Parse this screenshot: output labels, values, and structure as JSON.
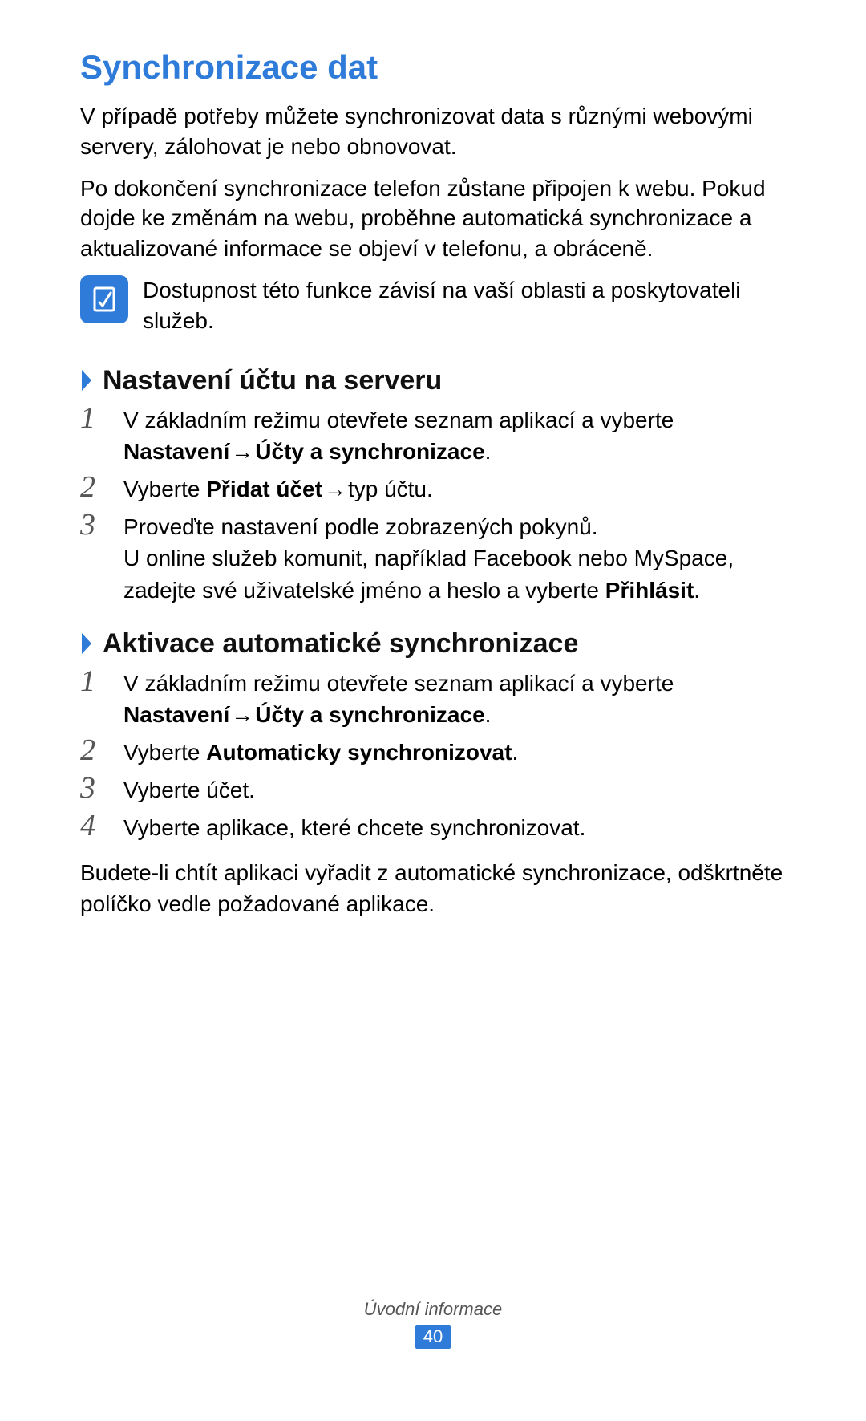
{
  "colors": {
    "accent": "#2f7bd9"
  },
  "heading": "Synchronizace dat",
  "intro_p1": "V případě potřeby můžete synchronizovat data s různými webovými servery, zálohovat je nebo obnovovat.",
  "intro_p2": "Po dokončení synchronizace telefon zůstane připojen k webu. Pokud dojde ke změnám na webu, proběhne automatická synchronizace a aktualizované informace se objeví v telefonu, a obráceně.",
  "note_icon": "note-icon",
  "note_text": "Dostupnost této funkce závisí na vaší oblasti a poskytovateli služeb.",
  "section1": {
    "title": "Nastavení účtu na serveru",
    "steps": {
      "s1": {
        "num": "1",
        "a": "V základním režimu otevřete seznam aplikací a vyberte ",
        "b1": "Nastavení",
        "arrow": " → ",
        "b2": "Účty a synchronizace",
        "c": "."
      },
      "s2": {
        "num": "2",
        "a": "Vyberte ",
        "b": "Přidat účet",
        "arrow": " → ",
        "c": "typ účtu."
      },
      "s3": {
        "num": "3",
        "line1": "Proveďte nastavení podle zobrazených pokynů.",
        "line2a": "U online služeb komunit, například Facebook nebo MySpace, zadejte své uživatelské jméno a heslo a vyberte ",
        "line2b": "Přihlásit",
        "line2c": "."
      }
    }
  },
  "section2": {
    "title": "Aktivace automatické synchronizace",
    "steps": {
      "s1": {
        "num": "1",
        "a": "V základním režimu otevřete seznam aplikací a vyberte ",
        "b1": "Nastavení",
        "arrow": " → ",
        "b2": "Účty a synchronizace",
        "c": "."
      },
      "s2": {
        "num": "2",
        "a": "Vyberte ",
        "b": "Automaticky synchronizovat",
        "c": "."
      },
      "s3": {
        "num": "3",
        "text": "Vyberte účet."
      },
      "s4": {
        "num": "4",
        "text": "Vyberte aplikace, které chcete synchronizovat."
      }
    },
    "after": "Budete-li chtít aplikaci vyřadit z automatické synchronizace, odškrtněte políčko vedle požadované aplikace."
  },
  "footer": {
    "section_label": "Úvodní informace",
    "page_number": "40"
  }
}
